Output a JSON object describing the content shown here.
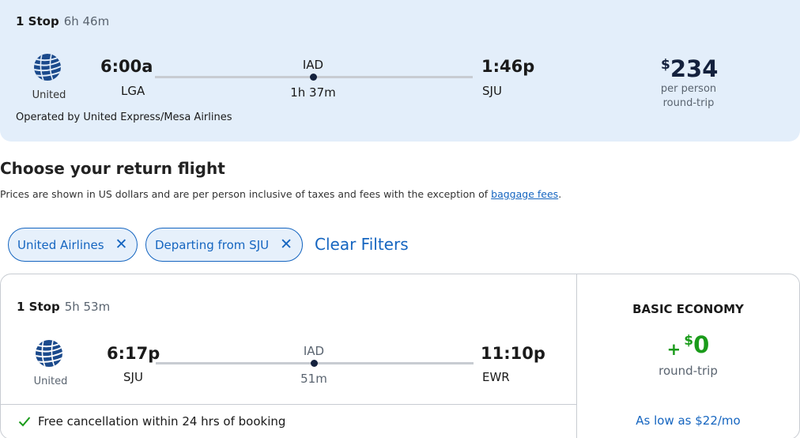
{
  "outbound": {
    "stops": "1 Stop",
    "duration": "6h 46m",
    "airline": "United",
    "depart_time": "6:00a",
    "depart_code": "LGA",
    "layover_code": "IAD",
    "layover_duration": "1h 37m",
    "arrive_time": "1:46p",
    "arrive_code": "SJU",
    "price_currency": "$",
    "price_amount": "234",
    "price_line1": "per person",
    "price_line2": "round-trip",
    "operated_by": "Operated by United Express/Mesa Airlines"
  },
  "section": {
    "title": "Choose your return flight",
    "note": "Prices are shown in US dollars and are per person inclusive of taxes and fees with the exception of ",
    "note_link": "baggage fees",
    "note_end": "."
  },
  "filters": {
    "chips": [
      "United Airlines",
      "Departing from SJU"
    ],
    "remove_glyph": "✕",
    "clear_label": "Clear Filters"
  },
  "return_flight": {
    "stops": "1 Stop",
    "duration": "5h 53m",
    "airline": "United",
    "depart_time": "6:17p",
    "depart_code": "SJU",
    "layover_code": "IAD",
    "layover_duration": "51m",
    "arrive_time": "11:10p",
    "arrive_code": "EWR",
    "cancellation_note": "Free cancellation within 24 hrs of booking",
    "fare": {
      "name": "BASIC ECONOMY",
      "plus": "+",
      "currency": "$",
      "amount": "0",
      "sub": "round-trip",
      "monthly": "As low as $22/mo"
    }
  },
  "colors": {
    "brand_blue": "#1565c0",
    "card_bg": "#e3eefa",
    "green": "#1a9b1a",
    "navy": "#14213d"
  }
}
